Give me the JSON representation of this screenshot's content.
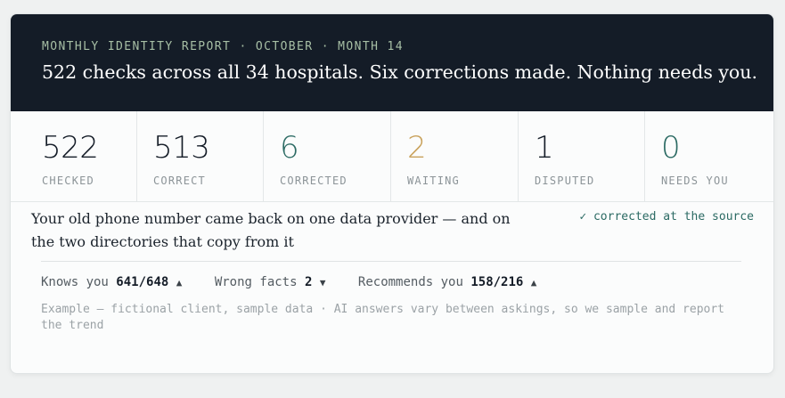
{
  "header": {
    "eyebrow": "MONTHLY IDENTITY REPORT · OCTOBER · MONTH 14",
    "headline": "522 checks across all 34 hospitals. Six corrections made. Nothing needs you."
  },
  "stats": [
    {
      "value": "522",
      "label": "CHECKED",
      "color": "#141c27"
    },
    {
      "value": "513",
      "label": "CORRECT",
      "color": "#141c27"
    },
    {
      "value": "6",
      "label": "CORRECTED",
      "color": "#2b6a63"
    },
    {
      "value": "2",
      "label": "WAITING",
      "color": "#c9a25c"
    },
    {
      "value": "1",
      "label": "DISPUTED",
      "color": "#141c27"
    },
    {
      "value": "0",
      "label": "NEEDS YOU",
      "color": "#2b6a63"
    }
  ],
  "detail": {
    "text": "Your old phone number came back on one data provider — and on the two directories that copy from it",
    "status": "✓ corrected at the source"
  },
  "metrics": [
    {
      "label": "Knows you ",
      "value": "641/648",
      "arrow": "▲"
    },
    {
      "label": "Wrong facts ",
      "value": "2",
      "arrow": "▼"
    },
    {
      "label": "Recommends you ",
      "value": "158/216",
      "arrow": "▲"
    }
  ],
  "footnote": "Example — fictional client, sample data · AI answers vary between askings, so we sample and report the trend"
}
